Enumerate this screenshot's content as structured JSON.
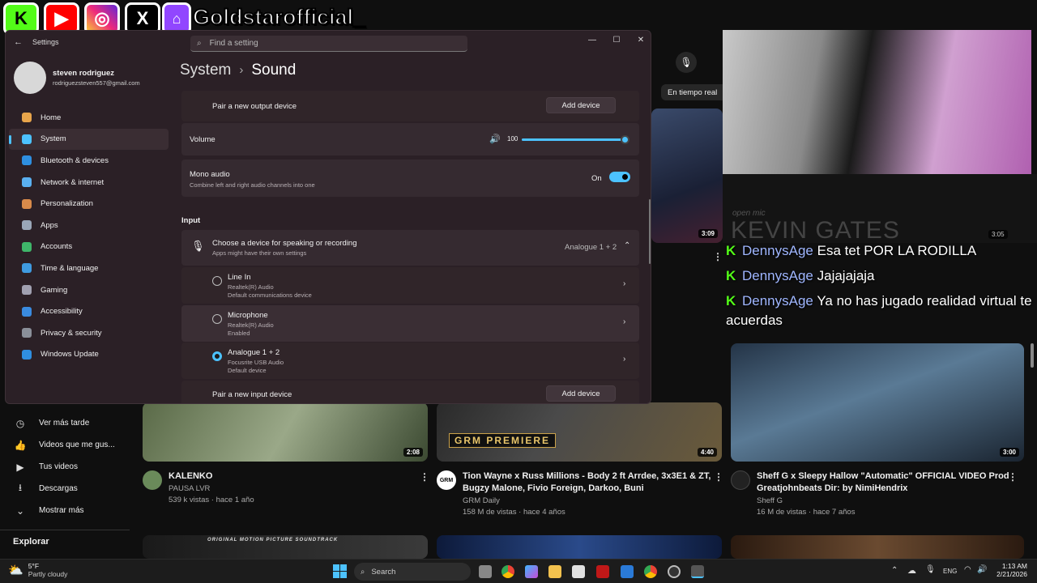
{
  "overlay": {
    "channel": "Goldstarofficial_",
    "socials": [
      {
        "name": "kick",
        "glyph": "K",
        "color": "#53fc18",
        "fg": "#000"
      },
      {
        "name": "youtube",
        "glyph": "▶",
        "color": "#ff0000",
        "fg": "#fff"
      },
      {
        "name": "instagram",
        "glyph": "◎",
        "color": "#d62976",
        "fg": "#fff"
      },
      {
        "name": "x",
        "glyph": "X",
        "color": "#000000",
        "fg": "#fff"
      },
      {
        "name": "twitch",
        "glyph": "⌂",
        "color": "#9146ff",
        "fg": "#fff"
      }
    ],
    "chat": [
      {
        "user": "DennysAge",
        "msg": "Esa tet POR LA RODILLA"
      },
      {
        "user": "DennysAge",
        "msg": "Jajajajaja"
      },
      {
        "user": "DennysAge",
        "msg": "Ya no has jugado realidad virtual te",
        "msg2": "acuerdas"
      }
    ],
    "kevin_gates": "KEVIN GATES",
    "open_mic": "open mic"
  },
  "youtube": {
    "live_chip": "En tiempo real",
    "sidebar": [
      {
        "label": "Ver más tarde",
        "icon": "clock-icon",
        "glyph": "◷"
      },
      {
        "label": "Videos que me gus...",
        "icon": "thumbs-up-icon",
        "glyph": "👍"
      },
      {
        "label": "Tus videos",
        "icon": "play-box-icon",
        "glyph": "▶"
      },
      {
        "label": "Descargas",
        "icon": "download-icon",
        "glyph": "⭳"
      },
      {
        "label": "Mostrar más",
        "icon": "chevron-down-icon",
        "glyph": "⌄"
      }
    ],
    "explore": "Explorar",
    "videos": [
      {
        "title": "KALENKO",
        "title2": "",
        "channel": "PAUSA LVR",
        "meta": "539 k vistas · hace 1 año",
        "duration": "2:08"
      },
      {
        "title": "Tion Wayne x Russ Millions - Body 2 ft Arrdee, 3x3E1 & ZT,",
        "title2": "Bugzy Malone, Fivio Foreign, Darkoo, Buni",
        "channel": "GRM Daily",
        "meta": "158 M de vistas · hace 4 años",
        "duration": "4:40",
        "badge": "GRM PREMIERE"
      },
      {
        "title": "Sheff G x Sleepy Hallow \"Automatic\" OFFICIAL VIDEO Prod",
        "title2": "Greatjohnbeats Dir: by NimiHendrix",
        "channel": "Sheff G",
        "meta": "16 M de vistas · hace 7 años",
        "duration": "3:00"
      }
    ],
    "top_durations": [
      "3:09",
      "3:05"
    ],
    "soundtrack": "ORIGINAL MOTION PICTURE SOUNDTRACK"
  },
  "settings": {
    "window_title": "Settings",
    "search_placeholder": "Find a setting",
    "user_name": "steven rodriguez",
    "user_email": "rodriguezsteven557@gmail.com",
    "nav": [
      {
        "label": "Home",
        "color": "#e8a54b"
      },
      {
        "label": "System",
        "color": "#4cc2ff"
      },
      {
        "label": "Bluetooth & devices",
        "color": "#2e8fe0"
      },
      {
        "label": "Network & internet",
        "color": "#5ab0f0"
      },
      {
        "label": "Personalization",
        "color": "#d88a4a"
      },
      {
        "label": "Apps",
        "color": "#9aa7b8"
      },
      {
        "label": "Accounts",
        "color": "#3fb66a"
      },
      {
        "label": "Time & language",
        "color": "#3f9be0"
      },
      {
        "label": "Gaming",
        "color": "#a0a0b0"
      },
      {
        "label": "Accessibility",
        "color": "#3a8be0"
      },
      {
        "label": "Privacy & security",
        "color": "#8a8f99"
      },
      {
        "label": "Windows Update",
        "color": "#2f8ee0"
      }
    ],
    "breadcrumb_parent": "System",
    "breadcrumb_sep": "›",
    "breadcrumb_current": "Sound",
    "pair_output": "Pair a new output device",
    "add_device": "Add device",
    "volume_label": "Volume",
    "volume_value": "100",
    "volume_level": 1.0,
    "mono_title": "Mono audio",
    "mono_desc": "Combine left and right audio channels into one",
    "mono_state": "On",
    "input_header": "Input",
    "choose_title": "Choose a device for speaking or recording",
    "choose_desc": "Apps might have their own settings",
    "selected_input": "Analogue 1 + 2",
    "inputs": [
      {
        "name": "Line In",
        "driver": "Realtek(R) Audio",
        "status": "Default communications device",
        "selected": false
      },
      {
        "name": "Microphone",
        "driver": "Realtek(R) Audio",
        "status": "Enabled",
        "selected": false
      },
      {
        "name": "Analogue 1 + 2",
        "driver": "Focusrite USB Audio",
        "status": "Default device",
        "selected": true
      }
    ],
    "pair_input": "Pair a new input device"
  },
  "taskbar": {
    "weather_temp": "5°F",
    "weather_desc": "Partly cloudy",
    "search": "Search",
    "lang": "ENG",
    "time": "1:13 AM",
    "date": "2/21/2026"
  }
}
